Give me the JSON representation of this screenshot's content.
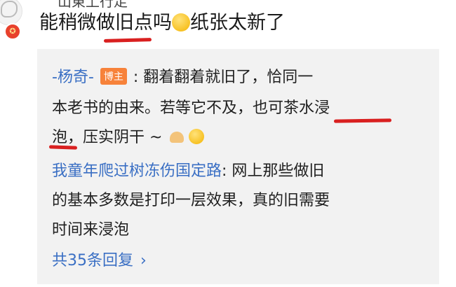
{
  "comment": {
    "top_cut_text": "山東上行走",
    "text_part1": "能稍微",
    "text_highlight": "做旧",
    "text_part2": "点吗",
    "text_part3": "纸张太新了",
    "emoji_icon": "crying-laughing-emoji"
  },
  "replies": [
    {
      "user": "-杨奇-",
      "badge": "博主",
      "line1": ": 翻着翻着就旧了，恰同一",
      "line2": "本老书的由来。若等它不及，也可茶水浸",
      "line3_highlight": "泡",
      "line3_rest": "，压实阴干 ~",
      "icons": [
        "hand-icon",
        "smile-emoji"
      ]
    },
    {
      "user": "我童年爬过树冻伤国定路",
      "line1": ": 网上那些做旧",
      "line2": "的基本多数是打印一层效果，真的旧需要",
      "line3": "时间来浸泡"
    }
  ],
  "more_replies": "共35条回复",
  "colors": {
    "link": "#3a6fc4",
    "underline": "#d92020",
    "badge": "#f7823a"
  }
}
